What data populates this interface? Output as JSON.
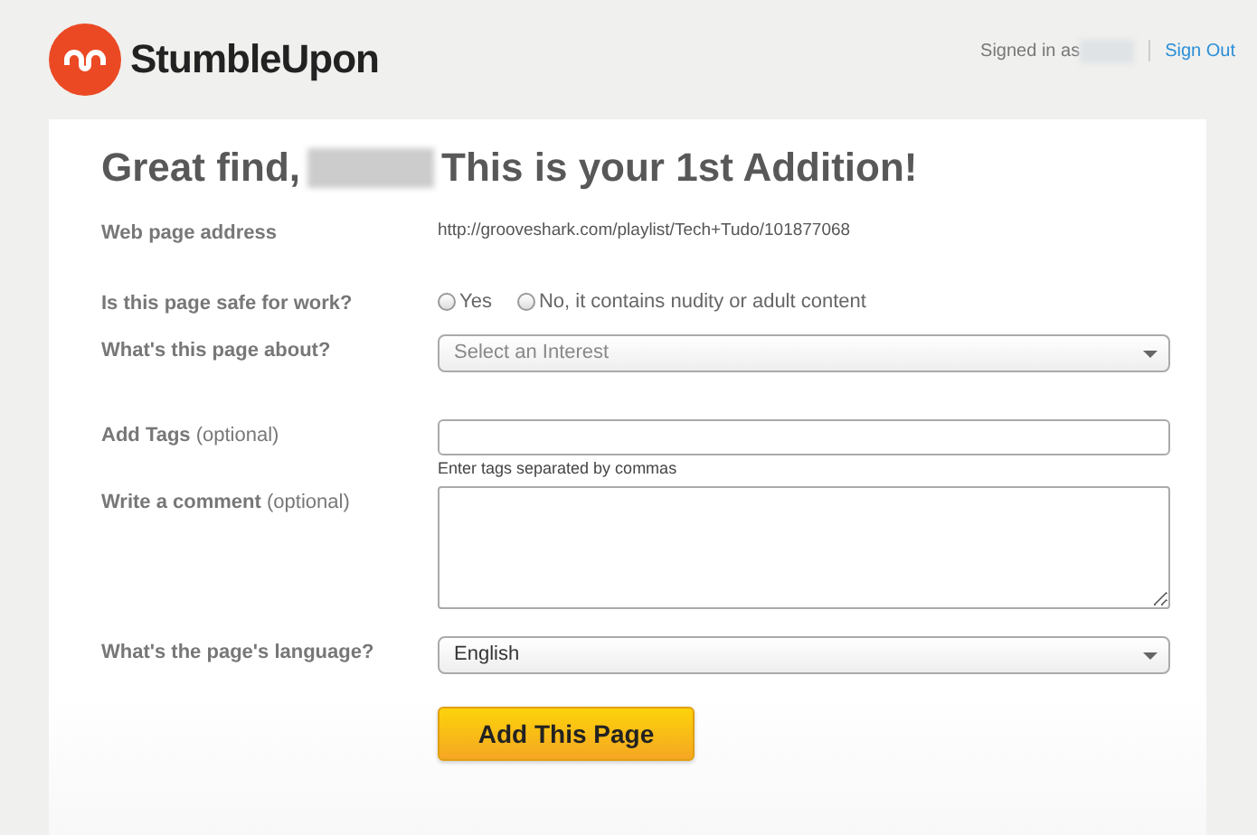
{
  "header": {
    "logo_text": "StumbleUpon",
    "signed_in_label": "Signed in as",
    "sign_out": "Sign Out"
  },
  "title": {
    "before": "Great find,",
    "after": "This is your 1st Addition!"
  },
  "form": {
    "address": {
      "label": "Web page address",
      "value": "http://grooveshark.com/playlist/Tech+Tudo/101877068"
    },
    "safe": {
      "label": "Is this page safe for work?",
      "options": [
        {
          "label": "Yes",
          "selected": false
        },
        {
          "label": "No, it contains nudity or adult content",
          "selected": false
        }
      ]
    },
    "about": {
      "label": "What's this page about?",
      "value": "Select an Interest"
    },
    "tags": {
      "label": "**Add Tags** (optional)",
      "hint": "Enter tags separated by commas"
    },
    "comment": {
      "label": "**Write a comment** (optional)"
    },
    "language": {
      "label": "What's the page's language?",
      "value": "English"
    }
  },
  "submit": "Add This Page"
}
